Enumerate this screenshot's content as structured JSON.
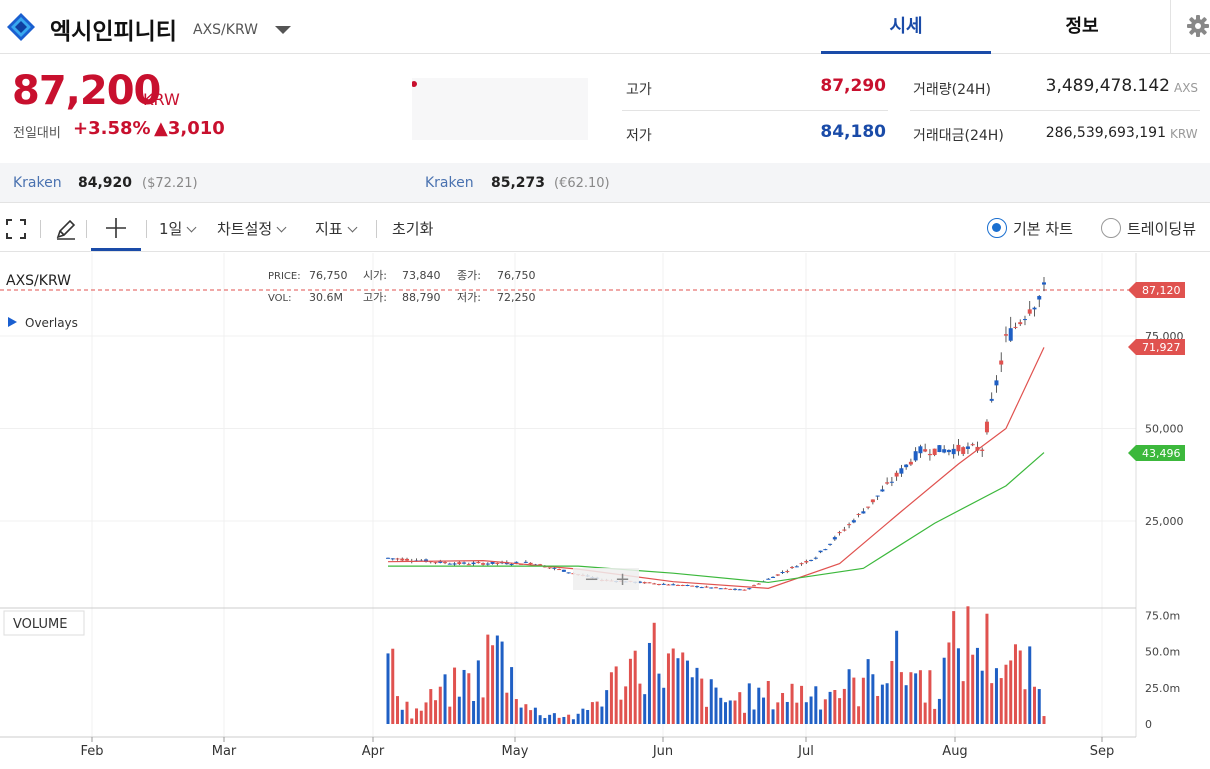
{
  "header": {
    "coin_name": "엑시인피니티",
    "pair": "AXS/KRW",
    "tabs": [
      {
        "label": "시세",
        "active": true
      },
      {
        "label": "정보",
        "active": false
      }
    ]
  },
  "price": {
    "current": "87,200",
    "unit": "KRW",
    "change_label": "전일대비",
    "change_pct": "+3.58%",
    "change_amount": "▲3,010"
  },
  "stats": {
    "high_label": "고가",
    "high": "87,290",
    "low_label": "저가",
    "low": "84,180",
    "volume_label": "거래량(24H)",
    "volume": "3,489,478.142",
    "volume_unit": "AXS",
    "turnover_label": "거래대금(24H)",
    "turnover": "286,539,693,191",
    "turnover_unit": "KRW"
  },
  "exchanges": [
    {
      "name": "Kraken",
      "price": "84,920",
      "sub": "($72.21)"
    },
    {
      "name": "Kraken",
      "price": "85,273",
      "sub": "(€62.10)"
    }
  ],
  "toolbar": {
    "interval": "1일",
    "chart_settings": "차트설정",
    "indicators": "지표",
    "reset": "초기화",
    "basic_chart": "기본 차트",
    "tradingview": "트레이딩뷰"
  },
  "chart_info": {
    "symbol": "AXS/KRW",
    "overlays": "Overlays",
    "price_label": "PRICE:",
    "price_val": "76,750",
    "open_label": "시가:",
    "open_val": "73,840",
    "close_label": "종가:",
    "close_val": "76,750",
    "vol_label": "VOL:",
    "vol_val": "30.6M",
    "high_label": "고가:",
    "high_val": "88,790",
    "low_label": "저가:",
    "low_val": "72,250",
    "volume_panel": "VOLUME",
    "zoom_out": "−",
    "zoom_in": "+"
  },
  "colors": {
    "up": "#e0524f",
    "down": "#1f5fc4",
    "ma_short": "#e0524f",
    "ma_long": "#3cb83c",
    "accent": "#1a4ba8"
  },
  "chart_data": {
    "type": "candlestick",
    "x_ticks": [
      "Feb",
      "Mar",
      "Apr",
      "May",
      "Jun",
      "Jul",
      "Aug",
      "Sep"
    ],
    "y_ticks": [
      "75,000",
      "50,000",
      "25,000"
    ],
    "volume_ticks": [
      "75.0m",
      "50.0m",
      "25.0m",
      "0"
    ],
    "last_price_label": "87,120",
    "ma_short_label": "71,927",
    "ma_long_label": "43,496",
    "close_series": [
      {
        "day": 0,
        "close": 15000
      },
      {
        "day": 15,
        "close": 13500
      },
      {
        "day": 30,
        "close": 13700
      },
      {
        "day": 45,
        "close": 9100
      },
      {
        "day": 60,
        "close": 7800
      },
      {
        "day": 75,
        "close": 6300
      },
      {
        "day": 90,
        "close": 15300
      },
      {
        "day": 100,
        "close": 27700
      },
      {
        "day": 112,
        "close": 44000
      },
      {
        "day": 125,
        "close": 44600
      },
      {
        "day": 130,
        "close": 74000
      },
      {
        "day": 135,
        "close": 83000
      },
      {
        "day": 138,
        "close": 87120
      }
    ],
    "ma_short": [
      {
        "day": 0,
        "close": 14000
      },
      {
        "day": 20,
        "close": 14300
      },
      {
        "day": 40,
        "close": 12000
      },
      {
        "day": 60,
        "close": 8600
      },
      {
        "day": 80,
        "close": 6800
      },
      {
        "day": 95,
        "close": 13500
      },
      {
        "day": 108,
        "close": 27600
      },
      {
        "day": 120,
        "close": 40400
      },
      {
        "day": 130,
        "close": 50000
      },
      {
        "day": 138,
        "close": 71927
      }
    ],
    "ma_long": [
      {
        "day": 0,
        "close": 12800
      },
      {
        "day": 40,
        "close": 12800
      },
      {
        "day": 60,
        "close": 10900
      },
      {
        "day": 80,
        "close": 8400
      },
      {
        "day": 100,
        "close": 12200
      },
      {
        "day": 115,
        "close": 24400
      },
      {
        "day": 130,
        "close": 34500
      },
      {
        "day": 138,
        "close": 43496
      }
    ],
    "volume_millions": [
      {
        "day": 0,
        "vol": 56
      },
      {
        "day": 5,
        "vol": 8
      },
      {
        "day": 10,
        "vol": 25
      },
      {
        "day": 20,
        "vol": 45
      },
      {
        "day": 22,
        "vol": 75
      },
      {
        "day": 30,
        "vol": 12
      },
      {
        "day": 40,
        "vol": 6
      },
      {
        "day": 55,
        "vol": 68
      },
      {
        "day": 70,
        "vol": 21
      },
      {
        "day": 100,
        "vol": 35
      },
      {
        "day": 105,
        "vol": 59
      },
      {
        "day": 110,
        "vol": 49
      },
      {
        "day": 115,
        "vol": 32
      },
      {
        "day": 120,
        "vol": 76
      },
      {
        "day": 125,
        "vol": 73
      },
      {
        "day": 130,
        "vol": 56
      },
      {
        "day": 135,
        "vol": 45
      },
      {
        "day": 138,
        "vol": 18
      }
    ]
  }
}
